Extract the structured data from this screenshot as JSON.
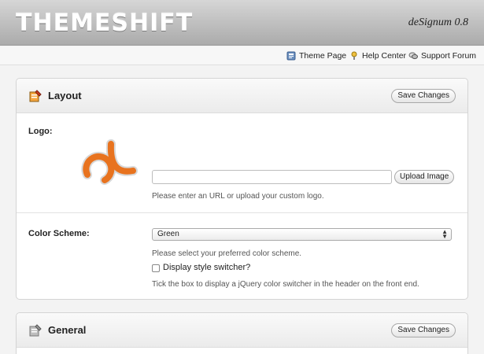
{
  "header": {
    "logo_text": "THEMESHIFT",
    "version": "deSignum 0.8"
  },
  "toolbar": {
    "links": [
      {
        "label": "Theme Page",
        "icon": "theme-page-icon"
      },
      {
        "label": "Help Center",
        "icon": "help-icon"
      },
      {
        "label": "Support Forum",
        "icon": "support-forum-icon"
      }
    ]
  },
  "layout_panel": {
    "title": "Layout",
    "save_label": "Save Changes",
    "logo": {
      "label": "Logo:",
      "url_value": "",
      "upload_label": "Upload Image",
      "hint": "Please enter an URL or upload your custom logo."
    },
    "color_scheme": {
      "label": "Color Scheme:",
      "selected": "Green",
      "hint": "Please select your preferred color scheme.",
      "checkbox_label": "Display style switcher?",
      "checkbox_checked": false,
      "checkbox_hint": "Tick the box to display a jQuery color switcher in the header on the front end."
    }
  },
  "general_panel": {
    "title": "General",
    "save_label": "Save Changes"
  },
  "colors": {
    "logo_orange": "#e8731f",
    "header_gray": "#b8b8b8"
  }
}
